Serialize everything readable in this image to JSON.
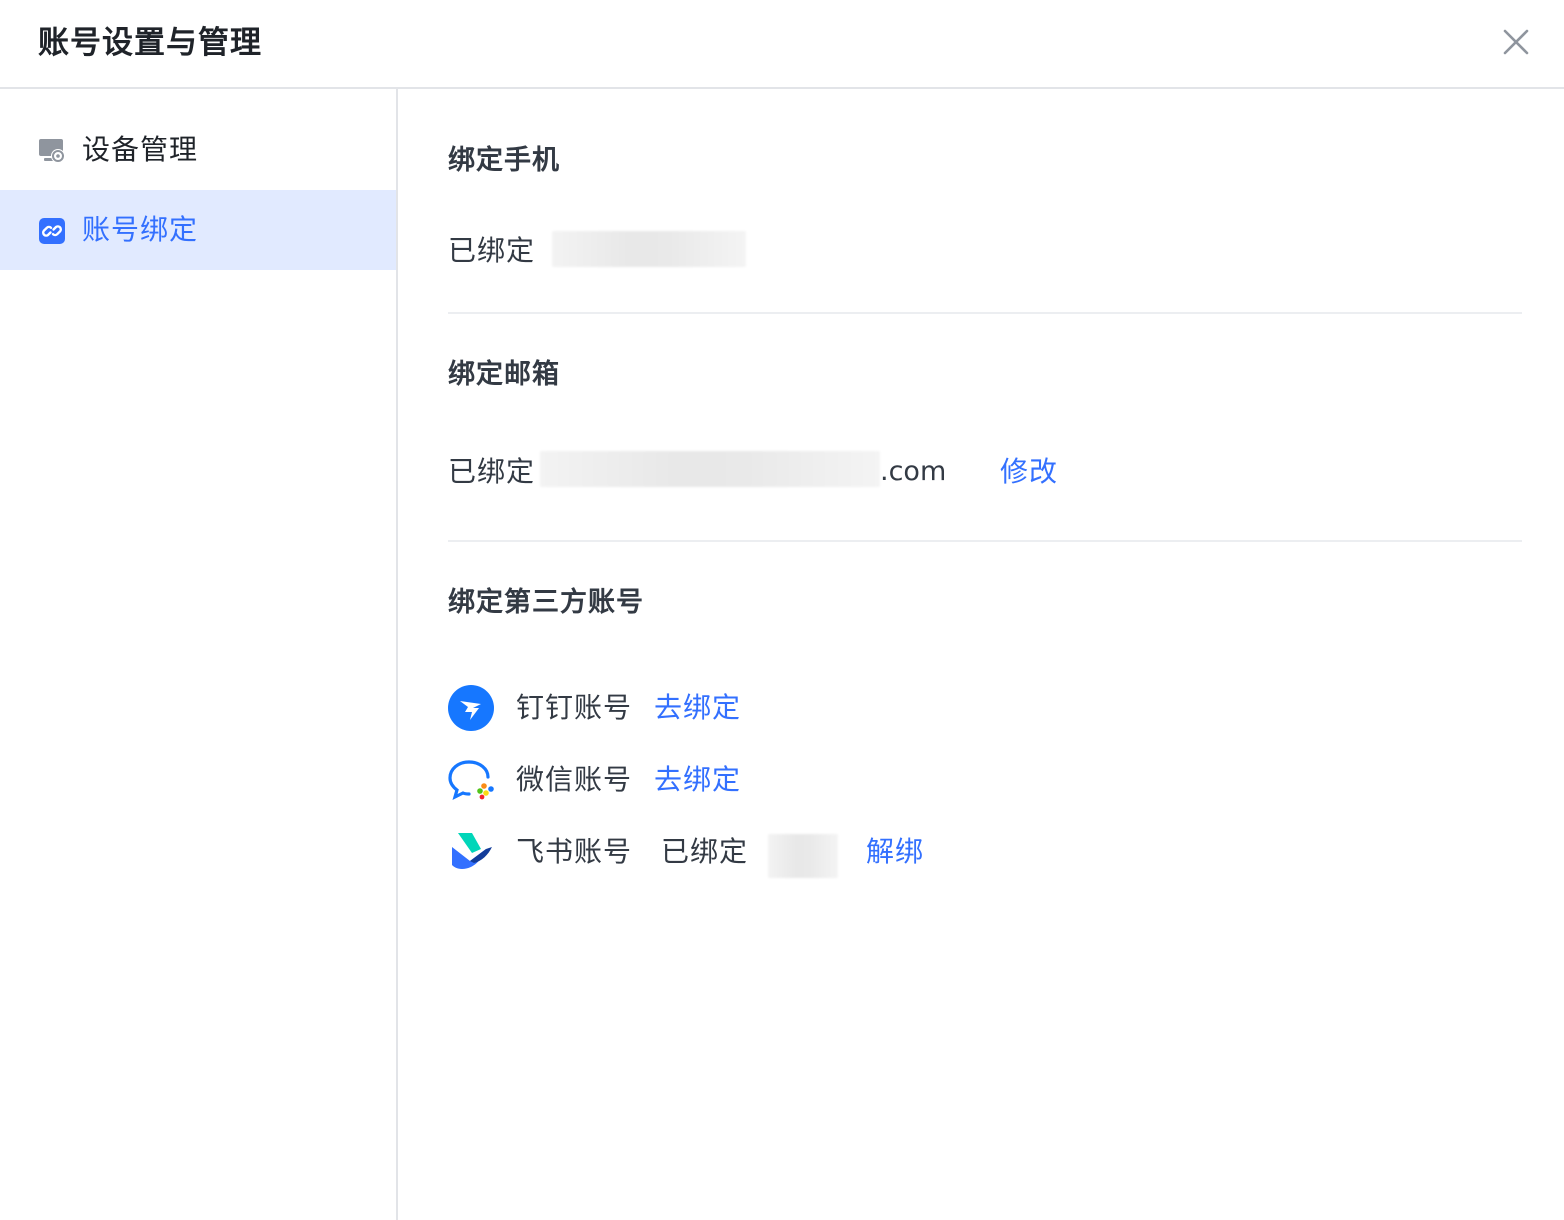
{
  "dialog": {
    "title": "账号设置与管理",
    "close_icon": "close-icon"
  },
  "sidebar": {
    "items": [
      {
        "label": "设备管理",
        "icon": "device-settings-icon",
        "active": false
      },
      {
        "label": "账号绑定",
        "icon": "link-icon",
        "active": true
      }
    ]
  },
  "phone": {
    "title": "绑定手机",
    "status": "已绑定"
  },
  "email": {
    "title": "绑定邮箱",
    "status": "已绑定",
    "suffix": ".com",
    "action": "修改"
  },
  "third_party": {
    "title": "绑定第三方账号",
    "accounts": [
      {
        "name": "钉钉账号",
        "icon": "dingtalk-icon",
        "action": "去绑定"
      },
      {
        "name": "微信账号",
        "icon": "wechat-work-icon",
        "action": "去绑定"
      },
      {
        "name": "飞书账号",
        "icon": "feishu-icon",
        "status": "已绑定",
        "action": "解绑"
      }
    ]
  },
  "colors": {
    "accent": "#3370ff",
    "active_bg": "#e1eaff",
    "text": "#333a44",
    "divider": "#eceef1"
  }
}
